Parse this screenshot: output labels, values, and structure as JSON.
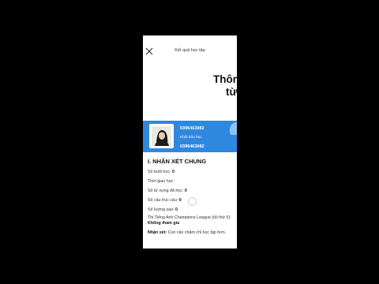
{
  "header": {
    "title": "Kết quả học tập"
  },
  "headline": {
    "line1": "Thôn",
    "line2": "từ"
  },
  "profile": {
    "phone": "0396463082",
    "group": "Khối tiểu học",
    "phone_repeat": "0396463082"
  },
  "overview": {
    "section_title": "I. NHẬN XÉT CHUNG",
    "sessions_label": "Số buổi học:",
    "sessions_value": "0",
    "study_time_label": "Thời gian học:",
    "vocab_label": "Số từ vựng đã học:",
    "vocab_value": "0",
    "structures_label": "Số cấu trúc câu:",
    "structures_value": "0",
    "stars_label": "Số lượng sao:",
    "stars_value": "0",
    "contest_label": "Thi Tiếng Anh Champions League (tối thứ 5):",
    "contest_value": "Không tham gia",
    "comment_label": "Nhận xét:",
    "comment_value": "Con cần chăm chỉ học tập hơn."
  },
  "colors": {
    "banner": "#2f88e0",
    "background": "#000000"
  },
  "icons": {
    "close": "close-icon"
  }
}
